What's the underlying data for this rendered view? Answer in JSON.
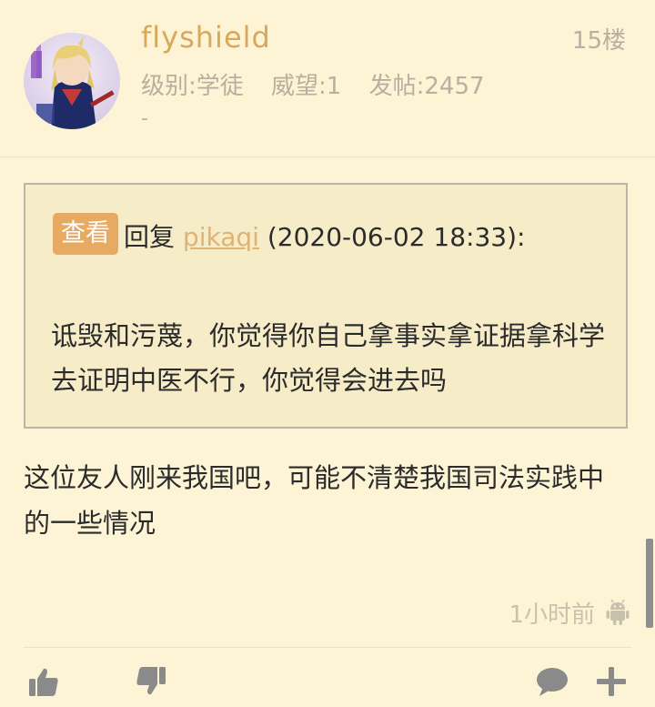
{
  "post": {
    "username": "flyshield",
    "floor": "15楼",
    "level": "级别:学徒",
    "prestige": "威望:1",
    "posts": "发帖:2457",
    "signature": "-",
    "quote": {
      "view_button": "查看",
      "reply_prefix": "回复",
      "reply_user": "pikaqi",
      "reply_time": "(2020-06-02 18:33):",
      "text": "诋毁和污蔑，你觉得你自己拿事实拿证据拿科学去证明中医不行，你觉得会进去吗"
    },
    "body": "这位友人刚来我国吧，可能不清楚我国司法实践中的一些情况",
    "time": "1小时前",
    "device_icon": "android-icon"
  },
  "actions": {
    "like_icon": "thumbs-up-icon",
    "dislike_icon": "thumbs-down-icon",
    "comment_icon": "comment-bubble-icon",
    "more_icon": "plus-icon"
  }
}
